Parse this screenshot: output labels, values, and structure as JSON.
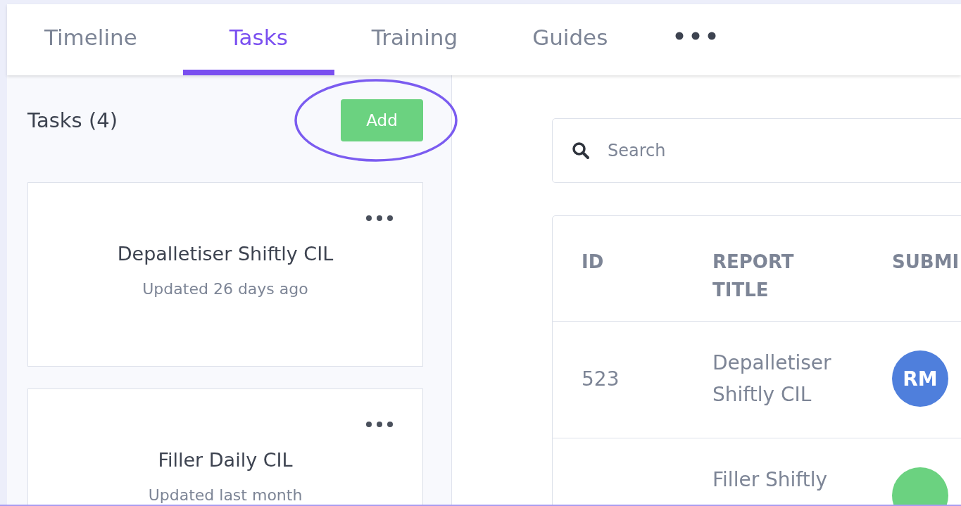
{
  "tabs": [
    {
      "label": "Timeline",
      "selected": false
    },
    {
      "label": "Tasks",
      "selected": true
    },
    {
      "label": "Training",
      "selected": false
    },
    {
      "label": "Guides",
      "selected": false
    }
  ],
  "tasks_panel": {
    "title": "Tasks (4)",
    "add_button": "Add",
    "highlighted": true,
    "cards": [
      {
        "title": "Depalletiser Shiftly CIL",
        "updated": "Updated 26 days ago"
      },
      {
        "title": "Filler Daily CIL",
        "updated": "Updated last month"
      }
    ]
  },
  "search": {
    "placeholder": "Search"
  },
  "table": {
    "columns": [
      {
        "lines": [
          "ID"
        ]
      },
      {
        "lines": [
          "REPORT",
          "TITLE"
        ]
      },
      {
        "lines": [
          "SUBMI"
        ]
      }
    ],
    "rows": [
      {
        "id": "523",
        "title": [
          "Depalletiser",
          "Shiftly CIL"
        ],
        "initials": "RM",
        "color": "#4f7fdc"
      },
      {
        "id": "",
        "title": [
          "Filler Shiftly"
        ],
        "initials": "",
        "color": "#6bd280"
      }
    ]
  }
}
